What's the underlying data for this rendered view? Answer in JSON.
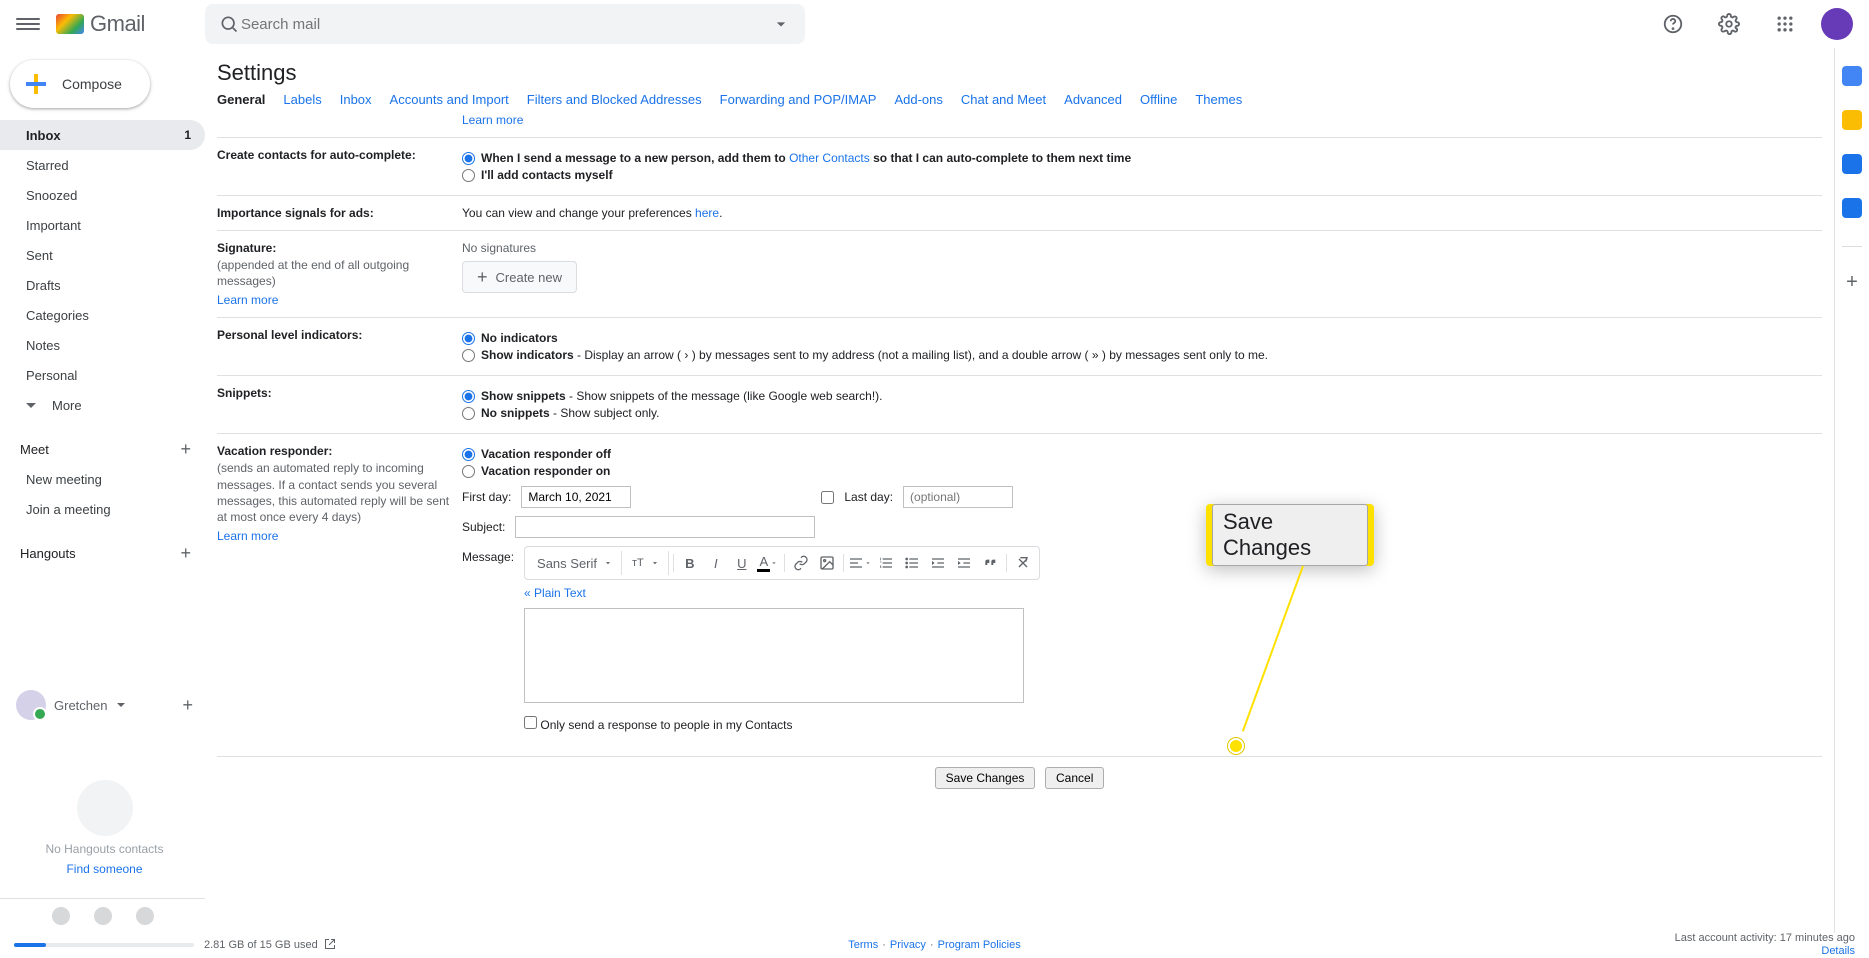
{
  "header": {
    "product_name": "Gmail",
    "search_placeholder": "Search mail",
    "avatar_initial": ""
  },
  "sidebar": {
    "compose_label": "Compose",
    "nav": [
      {
        "label": "Inbox",
        "count": "1",
        "selected": true
      },
      {
        "label": "Starred"
      },
      {
        "label": "Snoozed"
      },
      {
        "label": "Important"
      },
      {
        "label": "Sent"
      },
      {
        "label": "Drafts"
      },
      {
        "label": "Categories"
      },
      {
        "label": "Notes"
      },
      {
        "label": "Personal"
      }
    ],
    "more_label": "More",
    "meet_header": "Meet",
    "meet_items": [
      {
        "label": "New meeting"
      },
      {
        "label": "Join a meeting"
      }
    ],
    "hangouts_header": "Hangouts",
    "hangouts_user": "Gretchen",
    "no_hangouts_line1": "No Hangouts contacts",
    "no_hangouts_link": "Find someone"
  },
  "settings": {
    "title": "Settings",
    "tabs": [
      {
        "label": "General",
        "active": true
      },
      {
        "label": "Labels"
      },
      {
        "label": "Inbox"
      },
      {
        "label": "Accounts and Import"
      },
      {
        "label": "Filters and Blocked Addresses"
      },
      {
        "label": "Forwarding and POP/IMAP"
      },
      {
        "label": "Add-ons"
      },
      {
        "label": "Chat and Meet"
      },
      {
        "label": "Advanced"
      },
      {
        "label": "Offline"
      },
      {
        "label": "Themes"
      }
    ],
    "learn_more": "Learn more",
    "autocomplete": {
      "title": "Create contacts for auto-complete:",
      "opt1_prefix": "When I send a message to a new person, add them to ",
      "opt1_link": "Other Contacts",
      "opt1_suffix": " so that I can auto-complete to them next time",
      "opt2": "I'll add contacts myself"
    },
    "ads": {
      "title": "Importance signals for ads:",
      "body_prefix": "You can view and change your preferences ",
      "body_link": "here",
      "body_suffix": "."
    },
    "signature": {
      "title": "Signature:",
      "desc": "(appended at the end of all outgoing messages)",
      "none": "No signatures",
      "create_new": "Create new"
    },
    "indicators": {
      "title": "Personal level indicators:",
      "opt1": "No indicators",
      "opt2_label": "Show indicators",
      "opt2_rest": " - Display an arrow ( › ) by messages sent to my address (not a mailing list), and a double arrow ( » ) by messages sent only to me."
    },
    "snippets": {
      "title": "Snippets:",
      "opt1_label": "Show snippets",
      "opt1_rest": " - Show snippets of the message (like Google web search!).",
      "opt2_label": "No snippets",
      "opt2_rest": " - Show subject only."
    },
    "vacation": {
      "title": "Vacation responder:",
      "desc": "(sends an automated reply to incoming messages. If a contact sends you several messages, this automated reply will be sent at most once every 4 days)",
      "opt_off": "Vacation responder off",
      "opt_on": "Vacation responder on",
      "first_day_label": "First day:",
      "first_day_value": "March 10, 2021",
      "last_day_label": "Last day:",
      "last_day_placeholder": "(optional)",
      "subject_label": "Subject:",
      "subject_value": "",
      "message_label": "Message:",
      "font_family": "Sans Serif",
      "plain_text": "« Plain Text",
      "only_contacts": "Only send a response to people in my Contacts"
    },
    "actions": {
      "save": "Save Changes",
      "cancel": "Cancel"
    },
    "callout_save": "Save Changes"
  },
  "footer": {
    "storage": "2.81 GB of 15 GB used",
    "terms": "Terms",
    "privacy": "Privacy",
    "policies": "Program Policies",
    "dot": "·",
    "activity": "Last account activity: 17 minutes ago",
    "details": "Details"
  }
}
